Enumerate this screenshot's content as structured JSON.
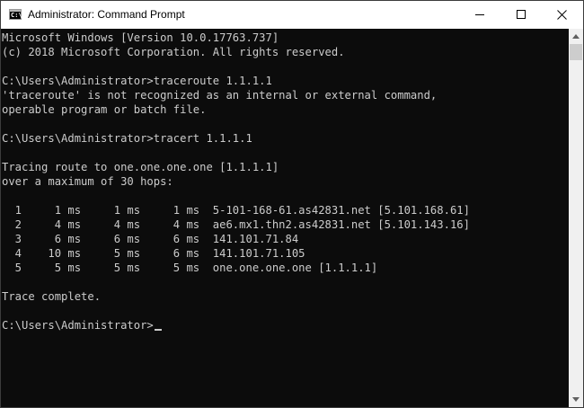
{
  "window": {
    "title": "Administrator: Command Prompt",
    "icon": "cmd-icon",
    "icon_glyph": "C:\\"
  },
  "controls": {
    "minimize_icon": "minimize-icon",
    "maximize_icon": "maximize-icon",
    "close_icon": "close-icon"
  },
  "console": {
    "lines": [
      "Microsoft Windows [Version 10.0.17763.737]",
      "(c) 2018 Microsoft Corporation. All rights reserved.",
      "",
      "C:\\Users\\Administrator>traceroute 1.1.1.1",
      "'traceroute' is not recognized as an internal or external command,",
      "operable program or batch file.",
      "",
      "C:\\Users\\Administrator>tracert 1.1.1.1",
      "",
      "Tracing route to one.one.one.one [1.1.1.1]",
      "over a maximum of 30 hops:",
      "",
      "  1     1 ms     1 ms     1 ms  5-101-168-61.as42831.net [5.101.168.61]",
      "  2     4 ms     4 ms     4 ms  ae6.mx1.thn2.as42831.net [5.101.143.16]",
      "  3     6 ms     6 ms     6 ms  141.101.71.84",
      "  4    10 ms     5 ms     6 ms  141.101.71.105",
      "  5     5 ms     5 ms     5 ms  one.one.one.one [1.1.1.1]",
      "",
      "Trace complete.",
      "",
      "C:\\Users\\Administrator>"
    ]
  },
  "scrollbar": {
    "up_icon": "scroll-up-arrow-icon",
    "down_icon": "scroll-down-arrow-icon",
    "colors": {
      "track": "#f0f0f0",
      "thumb": "#cdcdcd"
    }
  },
  "colors": {
    "console_background": "#0c0c0c",
    "console_text": "#cccccc",
    "titlebar_background": "#ffffff"
  }
}
